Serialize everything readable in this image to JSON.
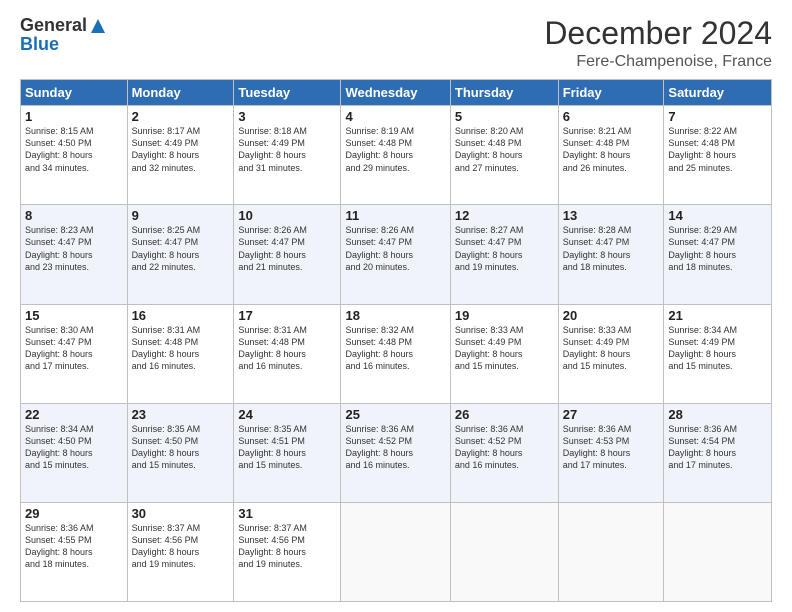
{
  "header": {
    "logo_general": "General",
    "logo_blue": "Blue",
    "month": "December 2024",
    "location": "Fere-Champenoise, France"
  },
  "weekdays": [
    "Sunday",
    "Monday",
    "Tuesday",
    "Wednesday",
    "Thursday",
    "Friday",
    "Saturday"
  ],
  "weeks": [
    [
      {
        "day": "1",
        "info": "Sunrise: 8:15 AM\nSunset: 4:50 PM\nDaylight: 8 hours\nand 34 minutes."
      },
      {
        "day": "2",
        "info": "Sunrise: 8:17 AM\nSunset: 4:49 PM\nDaylight: 8 hours\nand 32 minutes."
      },
      {
        "day": "3",
        "info": "Sunrise: 8:18 AM\nSunset: 4:49 PM\nDaylight: 8 hours\nand 31 minutes."
      },
      {
        "day": "4",
        "info": "Sunrise: 8:19 AM\nSunset: 4:48 PM\nDaylight: 8 hours\nand 29 minutes."
      },
      {
        "day": "5",
        "info": "Sunrise: 8:20 AM\nSunset: 4:48 PM\nDaylight: 8 hours\nand 27 minutes."
      },
      {
        "day": "6",
        "info": "Sunrise: 8:21 AM\nSunset: 4:48 PM\nDaylight: 8 hours\nand 26 minutes."
      },
      {
        "day": "7",
        "info": "Sunrise: 8:22 AM\nSunset: 4:48 PM\nDaylight: 8 hours\nand 25 minutes."
      }
    ],
    [
      {
        "day": "8",
        "info": "Sunrise: 8:23 AM\nSunset: 4:47 PM\nDaylight: 8 hours\nand 23 minutes."
      },
      {
        "day": "9",
        "info": "Sunrise: 8:25 AM\nSunset: 4:47 PM\nDaylight: 8 hours\nand 22 minutes."
      },
      {
        "day": "10",
        "info": "Sunrise: 8:26 AM\nSunset: 4:47 PM\nDaylight: 8 hours\nand 21 minutes."
      },
      {
        "day": "11",
        "info": "Sunrise: 8:26 AM\nSunset: 4:47 PM\nDaylight: 8 hours\nand 20 minutes."
      },
      {
        "day": "12",
        "info": "Sunrise: 8:27 AM\nSunset: 4:47 PM\nDaylight: 8 hours\nand 19 minutes."
      },
      {
        "day": "13",
        "info": "Sunrise: 8:28 AM\nSunset: 4:47 PM\nDaylight: 8 hours\nand 18 minutes."
      },
      {
        "day": "14",
        "info": "Sunrise: 8:29 AM\nSunset: 4:47 PM\nDaylight: 8 hours\nand 18 minutes."
      }
    ],
    [
      {
        "day": "15",
        "info": "Sunrise: 8:30 AM\nSunset: 4:47 PM\nDaylight: 8 hours\nand 17 minutes."
      },
      {
        "day": "16",
        "info": "Sunrise: 8:31 AM\nSunset: 4:48 PM\nDaylight: 8 hours\nand 16 minutes."
      },
      {
        "day": "17",
        "info": "Sunrise: 8:31 AM\nSunset: 4:48 PM\nDaylight: 8 hours\nand 16 minutes."
      },
      {
        "day": "18",
        "info": "Sunrise: 8:32 AM\nSunset: 4:48 PM\nDaylight: 8 hours\nand 16 minutes."
      },
      {
        "day": "19",
        "info": "Sunrise: 8:33 AM\nSunset: 4:49 PM\nDaylight: 8 hours\nand 15 minutes."
      },
      {
        "day": "20",
        "info": "Sunrise: 8:33 AM\nSunset: 4:49 PM\nDaylight: 8 hours\nand 15 minutes."
      },
      {
        "day": "21",
        "info": "Sunrise: 8:34 AM\nSunset: 4:49 PM\nDaylight: 8 hours\nand 15 minutes."
      }
    ],
    [
      {
        "day": "22",
        "info": "Sunrise: 8:34 AM\nSunset: 4:50 PM\nDaylight: 8 hours\nand 15 minutes."
      },
      {
        "day": "23",
        "info": "Sunrise: 8:35 AM\nSunset: 4:50 PM\nDaylight: 8 hours\nand 15 minutes."
      },
      {
        "day": "24",
        "info": "Sunrise: 8:35 AM\nSunset: 4:51 PM\nDaylight: 8 hours\nand 15 minutes."
      },
      {
        "day": "25",
        "info": "Sunrise: 8:36 AM\nSunset: 4:52 PM\nDaylight: 8 hours\nand 16 minutes."
      },
      {
        "day": "26",
        "info": "Sunrise: 8:36 AM\nSunset: 4:52 PM\nDaylight: 8 hours\nand 16 minutes."
      },
      {
        "day": "27",
        "info": "Sunrise: 8:36 AM\nSunset: 4:53 PM\nDaylight: 8 hours\nand 17 minutes."
      },
      {
        "day": "28",
        "info": "Sunrise: 8:36 AM\nSunset: 4:54 PM\nDaylight: 8 hours\nand 17 minutes."
      }
    ],
    [
      {
        "day": "29",
        "info": "Sunrise: 8:36 AM\nSunset: 4:55 PM\nDaylight: 8 hours\nand 18 minutes."
      },
      {
        "day": "30",
        "info": "Sunrise: 8:37 AM\nSunset: 4:56 PM\nDaylight: 8 hours\nand 19 minutes."
      },
      {
        "day": "31",
        "info": "Sunrise: 8:37 AM\nSunset: 4:56 PM\nDaylight: 8 hours\nand 19 minutes."
      },
      {
        "day": "",
        "info": ""
      },
      {
        "day": "",
        "info": ""
      },
      {
        "day": "",
        "info": ""
      },
      {
        "day": "",
        "info": ""
      }
    ]
  ]
}
